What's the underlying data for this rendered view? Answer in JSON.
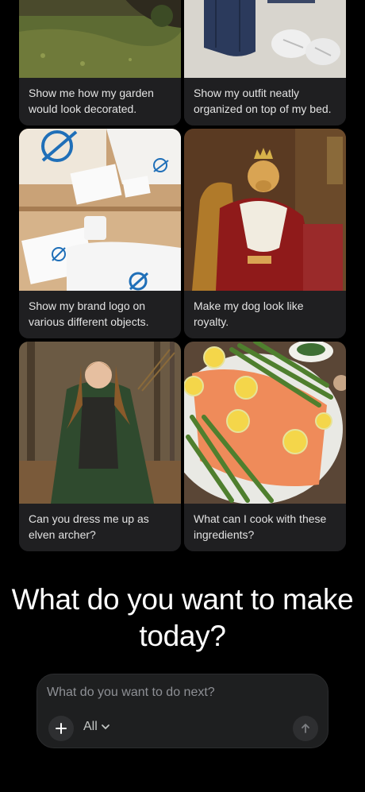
{
  "cards": [
    {
      "caption": "Show me how my garden would look decorated.",
      "image": "garden-photo"
    },
    {
      "caption": "Show my outfit neatly organized on top of my bed.",
      "image": "outfit-photo"
    },
    {
      "caption": "Show my brand logo on various different objects.",
      "image": "brand-logo-mockup"
    },
    {
      "caption": "Make my dog look like royalty.",
      "image": "royal-dog-painting"
    },
    {
      "caption": "Can you dress me up as elven archer?",
      "image": "elven-archer-photo"
    },
    {
      "caption": "What can I cook with these ingredients?",
      "image": "salmon-asparagus-dish"
    }
  ],
  "heading": "What do you want to make today?",
  "composer": {
    "placeholder": "What do you want to do next?",
    "mode": "All",
    "icons": {
      "add": "plus-icon",
      "mode": "chevron-down-icon",
      "send": "arrow-up-icon"
    }
  },
  "colors": {
    "background": "#000000",
    "card": "#1f1f21",
    "logo_blue": "#1f6fb8"
  }
}
